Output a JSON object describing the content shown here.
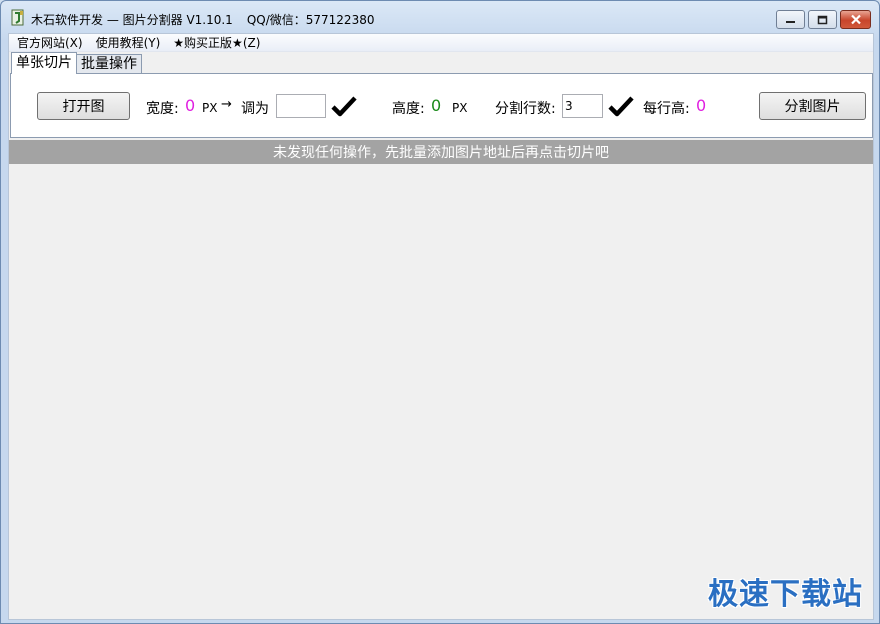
{
  "window": {
    "title": "木石软件开发 — 图片分割器 V1.10.1",
    "title_contact": "QQ/微信：577122380",
    "minimize_icon": "minimize-icon",
    "maximize_icon": "maximize-icon",
    "close_icon": "close-icon"
  },
  "menu": {
    "items": [
      "官方网站(X)",
      "使用教程(Y)",
      "★购买正版★(Z)"
    ]
  },
  "tabs": {
    "items": [
      "单张切片",
      "批量操作"
    ],
    "active": "单张切片"
  },
  "controls": {
    "open_button": "打开图",
    "width_label": "宽度:",
    "width_value": "0",
    "width_unit": "PX",
    "arrow": "→",
    "resize_label": "调为",
    "resize_value": "",
    "height_label": "高度:",
    "height_value": "0",
    "height_unit": "PX",
    "rows_label": "分割行数:",
    "rows_value": "3",
    "row_height_label": "每行高:",
    "row_height_value": "0",
    "split_button": "分割图片"
  },
  "status": {
    "message": "未发现任何操作，先批量添加图片地址后再点击切片吧"
  },
  "watermark": {
    "text": "极速下载站"
  },
  "colors": {
    "width_value": "#e020e0",
    "height_value": "#1a8a1a",
    "row_height_value": "#e020e0",
    "status_bg": "#a3a3a3",
    "watermark": "#2a6fc2"
  }
}
